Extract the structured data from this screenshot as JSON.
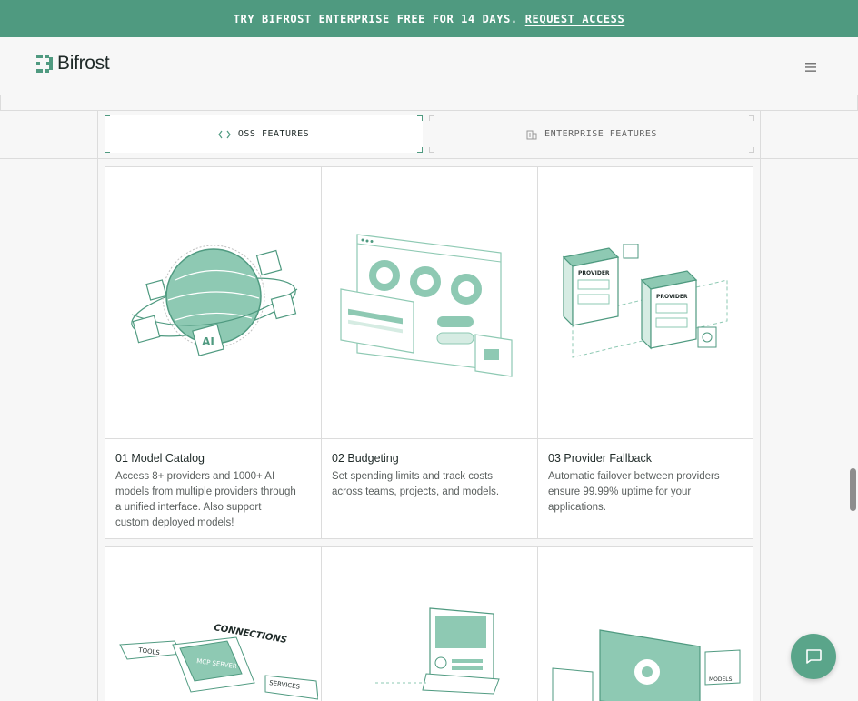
{
  "banner": {
    "text": "TRY BIFROST ENTERPRISE FREE FOR 14 DAYS.",
    "link": "REQUEST ACCESS"
  },
  "header": {
    "logo_text": "Bifrost",
    "menu_icon": "hamburger-icon"
  },
  "tabs": [
    {
      "label": "OSS FEATURES",
      "icon": "code-brackets-icon",
      "active": true
    },
    {
      "label": "ENTERPRISE FEATURES",
      "icon": "building-icon",
      "active": false
    }
  ],
  "features": [
    {
      "title": "01 Model Catalog",
      "description": "Access 8+ providers and 1000+ AI models from multiple providers through a unified interface. Also support custom deployed models!"
    },
    {
      "title": "02 Budgeting",
      "description": "Set spending limits and track costs across teams, projects, and models."
    },
    {
      "title": "03 Provider Fallback",
      "description": "Automatic failover between providers ensure 99.99% uptime for your applications."
    }
  ],
  "illustration_labels": {
    "provider": "PROVIDER",
    "ai": "AI",
    "connections": "CONNECTIONS",
    "tools": "TOOLS",
    "mcp_server": "MCP SERVER",
    "services": "SERVICES",
    "models": "MODELS"
  },
  "colors": {
    "brand": "#4f9a80",
    "accent_light": "#8ec9b3",
    "chat_button": "#5aa58a"
  },
  "chat_icon": "chat-bubble-icon"
}
